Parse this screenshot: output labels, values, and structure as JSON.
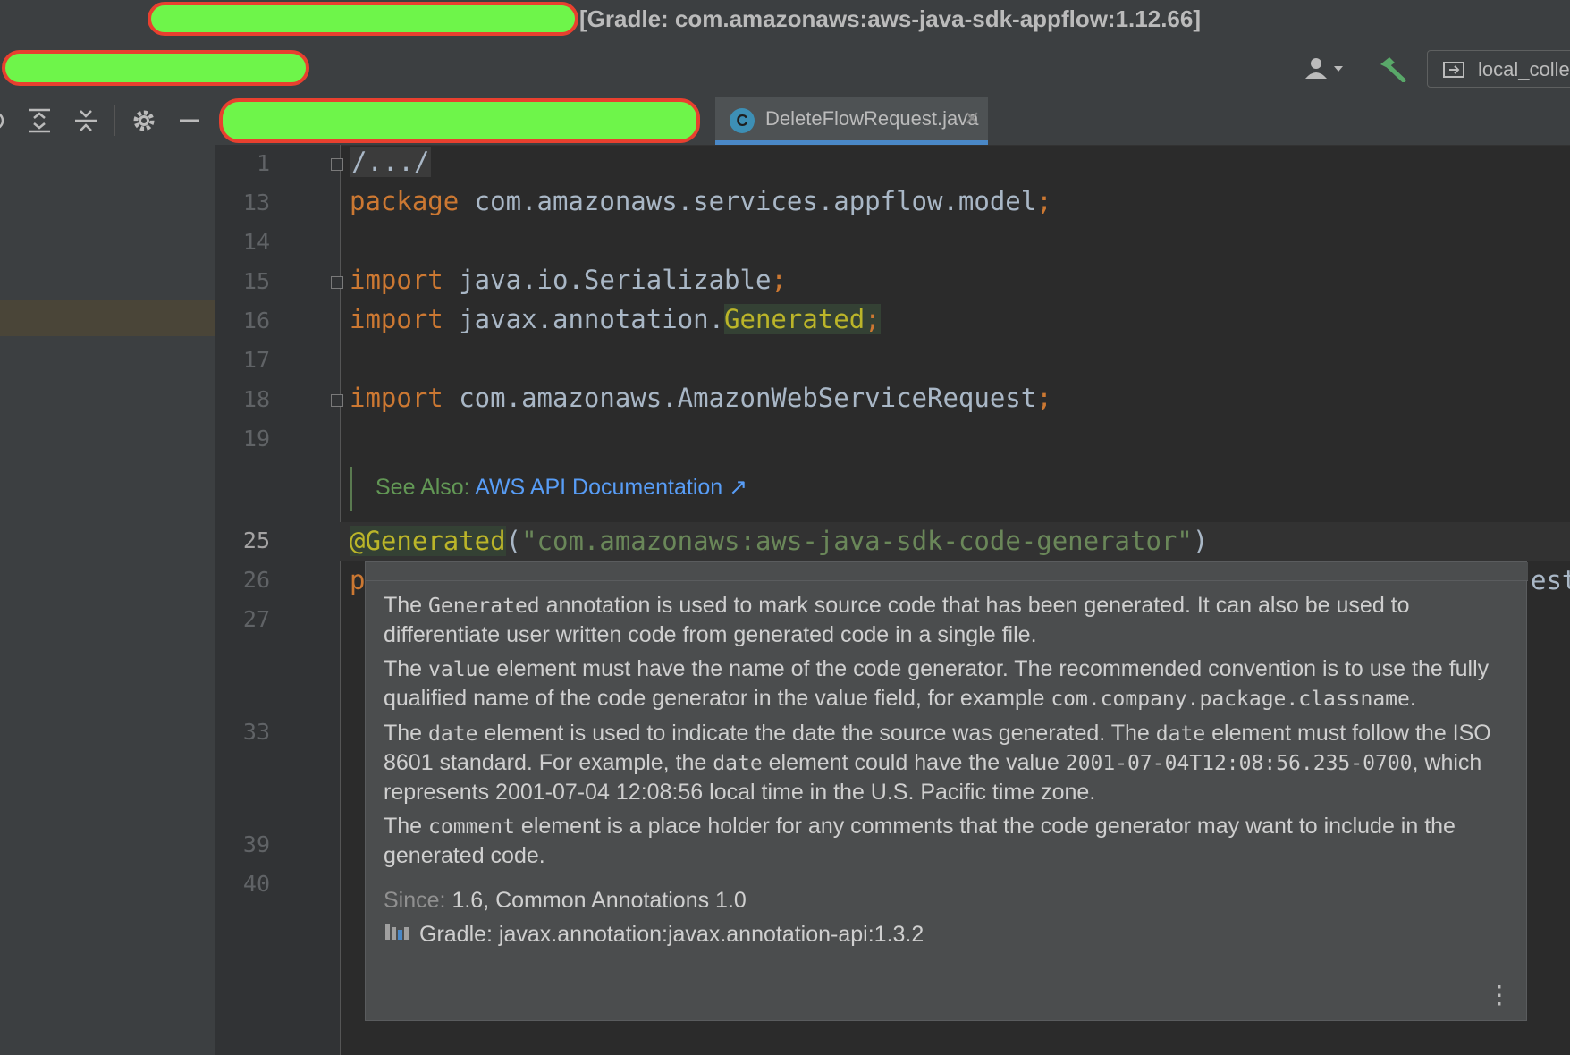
{
  "title_bar": {
    "title": "[Gradle: com.amazonaws:aws-java-sdk-appflow:1.12.66]"
  },
  "nav_bar": {
    "run_config": "local_colle"
  },
  "editor_tab": {
    "label": "DeleteFlowRequest.java",
    "icon_letter": "C"
  },
  "gutter": {
    "line_numbers": [
      "1",
      "13",
      "14",
      "15",
      "16",
      "17",
      "18",
      "19",
      "25",
      "26",
      "27",
      "33",
      "39",
      "40"
    ]
  },
  "code": {
    "l1": "/.../",
    "l13_kw": "package",
    "l13_rest": " com.amazonaws.services.appflow.model",
    "semicolon": ";",
    "import_kw": "import",
    "l15_rest": " java.io.Serializable",
    "l16_rest": " javax.annotation.",
    "l16_generated": "Generated",
    "l18_rest": " com.amazonaws.AmazonWebServiceRequest",
    "see_also_label": "See Also: ",
    "see_also_link": "AWS API Documentation ↗",
    "l25_annotation": "@Generated",
    "l25_open": "(",
    "l25_string": "\"com.amazonaws:aws-java-sdk-code-generator\"",
    "l25_close": ")",
    "l26_start": "p",
    "l26_end": "est"
  },
  "doc_popup": {
    "p1_a": "The ",
    "p1_code": "Generated",
    "p1_b": " annotation is used to mark source code that has been generated. It can also be used to differentiate user written code from generated code in a single file.",
    "p2_a": "The ",
    "p2_code": "value",
    "p2_b": " element must have the name of the code generator. The recommended convention is to use the fully qualified name of the code generator in the value field, for example ",
    "p2_code2": "com.company.package.classname",
    "p2_c": ".",
    "p3_a": "The ",
    "p3_code": "date",
    "p3_b": " element is used to indicate the date the source was generated. The ",
    "p3_code2": "date",
    "p3_c": " element must follow the ISO 8601 standard. For example, the ",
    "p3_code3": "date",
    "p3_d": " element could have the value ",
    "p3_code4": "2001-07-04T12:08:56.235-0700",
    "p3_e": ", which represents 2001-07-04 12:08:56 local time in the U.S. Pacific time zone.",
    "p4_a": "The ",
    "p4_code": "comment",
    "p4_b": " element is a place holder for any comments that the code generator may want to include in the generated code.",
    "since_label": "Since: ",
    "since_value": "1.6, Common Annotations 1.0",
    "library": "Gradle: javax.annotation:javax.annotation-api:1.3.2"
  },
  "colors": {
    "keyword": "#cc7832",
    "string": "#6a8759",
    "annotation": "#bbb529",
    "link": "#589df6",
    "active_tab_underline": "#4a88c7"
  }
}
